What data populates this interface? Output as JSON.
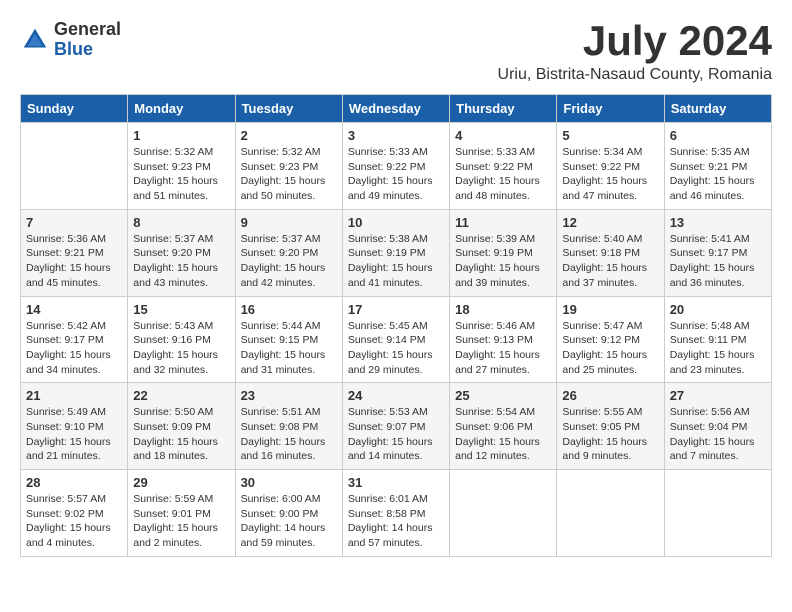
{
  "logo": {
    "general": "General",
    "blue": "Blue"
  },
  "title": "July 2024",
  "location": "Uriu, Bistrita-Nasaud County, Romania",
  "days_of_week": [
    "Sunday",
    "Monday",
    "Tuesday",
    "Wednesday",
    "Thursday",
    "Friday",
    "Saturday"
  ],
  "weeks": [
    [
      {
        "day": "",
        "info": ""
      },
      {
        "day": "1",
        "info": "Sunrise: 5:32 AM\nSunset: 9:23 PM\nDaylight: 15 hours\nand 51 minutes."
      },
      {
        "day": "2",
        "info": "Sunrise: 5:32 AM\nSunset: 9:23 PM\nDaylight: 15 hours\nand 50 minutes."
      },
      {
        "day": "3",
        "info": "Sunrise: 5:33 AM\nSunset: 9:22 PM\nDaylight: 15 hours\nand 49 minutes."
      },
      {
        "day": "4",
        "info": "Sunrise: 5:33 AM\nSunset: 9:22 PM\nDaylight: 15 hours\nand 48 minutes."
      },
      {
        "day": "5",
        "info": "Sunrise: 5:34 AM\nSunset: 9:22 PM\nDaylight: 15 hours\nand 47 minutes."
      },
      {
        "day": "6",
        "info": "Sunrise: 5:35 AM\nSunset: 9:21 PM\nDaylight: 15 hours\nand 46 minutes."
      }
    ],
    [
      {
        "day": "7",
        "info": "Sunrise: 5:36 AM\nSunset: 9:21 PM\nDaylight: 15 hours\nand 45 minutes."
      },
      {
        "day": "8",
        "info": "Sunrise: 5:37 AM\nSunset: 9:20 PM\nDaylight: 15 hours\nand 43 minutes."
      },
      {
        "day": "9",
        "info": "Sunrise: 5:37 AM\nSunset: 9:20 PM\nDaylight: 15 hours\nand 42 minutes."
      },
      {
        "day": "10",
        "info": "Sunrise: 5:38 AM\nSunset: 9:19 PM\nDaylight: 15 hours\nand 41 minutes."
      },
      {
        "day": "11",
        "info": "Sunrise: 5:39 AM\nSunset: 9:19 PM\nDaylight: 15 hours\nand 39 minutes."
      },
      {
        "day": "12",
        "info": "Sunrise: 5:40 AM\nSunset: 9:18 PM\nDaylight: 15 hours\nand 37 minutes."
      },
      {
        "day": "13",
        "info": "Sunrise: 5:41 AM\nSunset: 9:17 PM\nDaylight: 15 hours\nand 36 minutes."
      }
    ],
    [
      {
        "day": "14",
        "info": "Sunrise: 5:42 AM\nSunset: 9:17 PM\nDaylight: 15 hours\nand 34 minutes."
      },
      {
        "day": "15",
        "info": "Sunrise: 5:43 AM\nSunset: 9:16 PM\nDaylight: 15 hours\nand 32 minutes."
      },
      {
        "day": "16",
        "info": "Sunrise: 5:44 AM\nSunset: 9:15 PM\nDaylight: 15 hours\nand 31 minutes."
      },
      {
        "day": "17",
        "info": "Sunrise: 5:45 AM\nSunset: 9:14 PM\nDaylight: 15 hours\nand 29 minutes."
      },
      {
        "day": "18",
        "info": "Sunrise: 5:46 AM\nSunset: 9:13 PM\nDaylight: 15 hours\nand 27 minutes."
      },
      {
        "day": "19",
        "info": "Sunrise: 5:47 AM\nSunset: 9:12 PM\nDaylight: 15 hours\nand 25 minutes."
      },
      {
        "day": "20",
        "info": "Sunrise: 5:48 AM\nSunset: 9:11 PM\nDaylight: 15 hours\nand 23 minutes."
      }
    ],
    [
      {
        "day": "21",
        "info": "Sunrise: 5:49 AM\nSunset: 9:10 PM\nDaylight: 15 hours\nand 21 minutes."
      },
      {
        "day": "22",
        "info": "Sunrise: 5:50 AM\nSunset: 9:09 PM\nDaylight: 15 hours\nand 18 minutes."
      },
      {
        "day": "23",
        "info": "Sunrise: 5:51 AM\nSunset: 9:08 PM\nDaylight: 15 hours\nand 16 minutes."
      },
      {
        "day": "24",
        "info": "Sunrise: 5:53 AM\nSunset: 9:07 PM\nDaylight: 15 hours\nand 14 minutes."
      },
      {
        "day": "25",
        "info": "Sunrise: 5:54 AM\nSunset: 9:06 PM\nDaylight: 15 hours\nand 12 minutes."
      },
      {
        "day": "26",
        "info": "Sunrise: 5:55 AM\nSunset: 9:05 PM\nDaylight: 15 hours\nand 9 minutes."
      },
      {
        "day": "27",
        "info": "Sunrise: 5:56 AM\nSunset: 9:04 PM\nDaylight: 15 hours\nand 7 minutes."
      }
    ],
    [
      {
        "day": "28",
        "info": "Sunrise: 5:57 AM\nSunset: 9:02 PM\nDaylight: 15 hours\nand 4 minutes."
      },
      {
        "day": "29",
        "info": "Sunrise: 5:59 AM\nSunset: 9:01 PM\nDaylight: 15 hours\nand 2 minutes."
      },
      {
        "day": "30",
        "info": "Sunrise: 6:00 AM\nSunset: 9:00 PM\nDaylight: 14 hours\nand 59 minutes."
      },
      {
        "day": "31",
        "info": "Sunrise: 6:01 AM\nSunset: 8:58 PM\nDaylight: 14 hours\nand 57 minutes."
      },
      {
        "day": "",
        "info": ""
      },
      {
        "day": "",
        "info": ""
      },
      {
        "day": "",
        "info": ""
      }
    ]
  ]
}
